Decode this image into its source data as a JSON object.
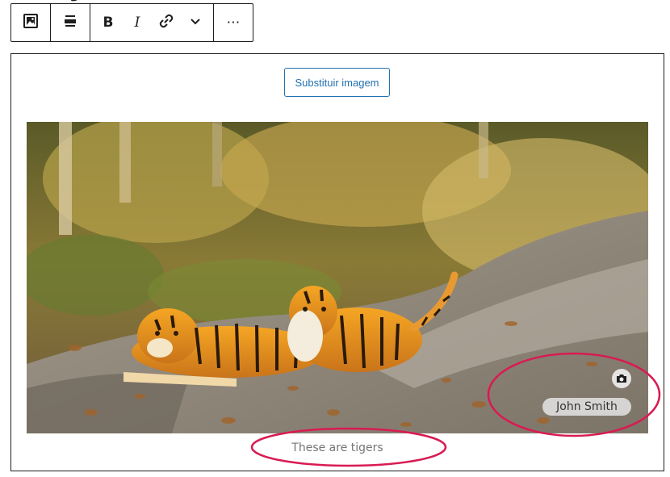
{
  "toolbar": {
    "groups": [
      {
        "items": [
          {
            "icon": "image-icon",
            "label": "Image"
          }
        ]
      },
      {
        "items": [
          {
            "icon": "align-center-icon",
            "label": "Align"
          }
        ]
      },
      {
        "items": [
          {
            "icon": "bold-icon",
            "glyph": "B"
          },
          {
            "icon": "italic-icon",
            "glyph": "I"
          },
          {
            "icon": "link-icon"
          },
          {
            "icon": "chevron-down-icon"
          }
        ]
      },
      {
        "items": [
          {
            "icon": "more-options-icon",
            "glyph": "⋯"
          }
        ]
      }
    ]
  },
  "image_block": {
    "replace_label": "Substituir imagem",
    "credit": {
      "name": "John Smith",
      "icon": "camera-icon"
    },
    "caption": "These are tigers"
  },
  "annotations": {
    "color": "#d81b52",
    "items": [
      "credit-highlight",
      "caption-highlight"
    ]
  },
  "colors": {
    "accent": "#2271b1",
    "border": "#1e1e1e",
    "caption": "#757575"
  }
}
